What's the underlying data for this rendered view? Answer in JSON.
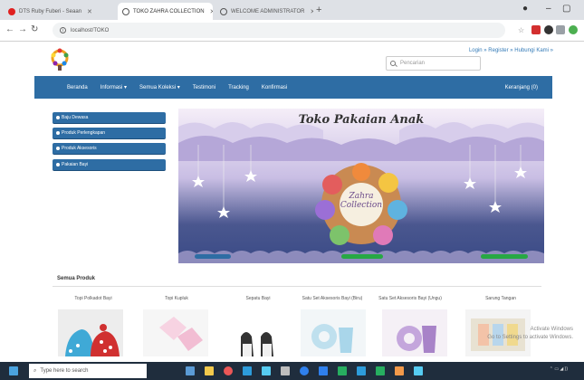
{
  "browser": {
    "tabs": [
      {
        "label": "DTS Ruby Fuberi - Seaan",
        "fav_color": "#e02020"
      },
      {
        "label": "TOKO ZAHRA COLLECTION",
        "fav_color": "#555555"
      },
      {
        "label": "WELCOME ADMINISTRATOR",
        "fav_color": "#555555"
      }
    ],
    "url": "localhost/TOKO"
  },
  "header": {
    "top_links": "Login » Register » Hubungi Kami »",
    "search_placeholder": "Pencarian"
  },
  "navbar": {
    "items": [
      "Beranda",
      "Informasi ▾",
      "Semua Koleksi ▾",
      "Testimoni",
      "Tracking",
      "Konfirmasi"
    ],
    "cart": "Keranjang (0)"
  },
  "sidebar": {
    "items": [
      "Baju Dewasa",
      "Produk Perlengkapan",
      "Produk Aksesoris",
      "Pakaian Bayi"
    ]
  },
  "banner": {
    "title": "Toko Pakaian Anak",
    "logo_line1": "Zahra",
    "logo_line2": "Collection"
  },
  "products": {
    "section_title": "Semua Produk",
    "items": [
      {
        "name": "Topi Polkadot Bayi",
        "icon": "hat-image"
      },
      {
        "name": "Topi Kupluk",
        "icon": "cloth-image"
      },
      {
        "name": "Sepatu Bayi",
        "icon": "shoes-image"
      },
      {
        "name": "Satu Set Aksesoris Bayi (Biru)",
        "icon": "bib-set-image"
      },
      {
        "name": "Satu Set Aksesoris Bayi (Ungu)",
        "icon": "bib-set-image"
      },
      {
        "name": "Sarung Tangan",
        "icon": "glove-image"
      }
    ]
  },
  "windows": {
    "search_placeholder": "Type here to search",
    "watermark_line1": "Activate Windows",
    "watermark_line2": "Go to Settings to activate Windows."
  }
}
